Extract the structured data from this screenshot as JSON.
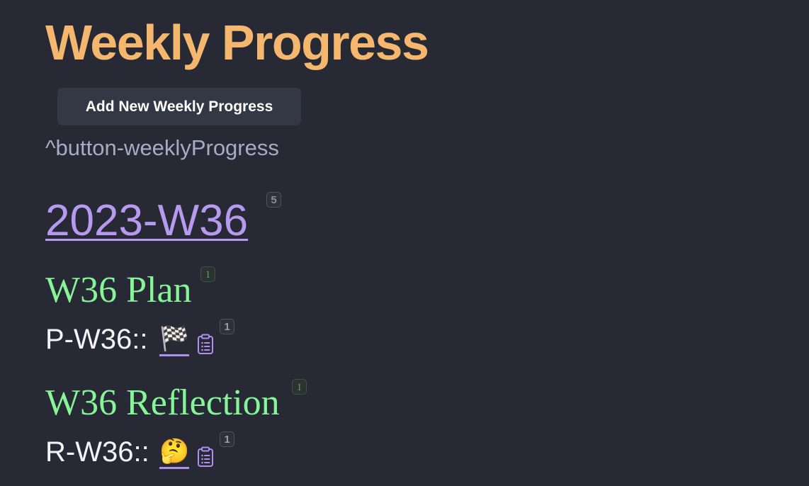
{
  "page": {
    "title": "Weekly Progress"
  },
  "button": {
    "label": "Add New Weekly Progress"
  },
  "block_ref": "^button-weeklyProgress",
  "week": {
    "link_label": "2023-W36",
    "count_badge": "5"
  },
  "plan": {
    "heading": "W36 Plan",
    "heading_badge": "1",
    "field_label": "P-W36::",
    "emoji": "🏁",
    "emoji_name": "chequered-flag",
    "badge": "1",
    "icon": "clipboard-list-icon"
  },
  "reflection": {
    "heading": "W36 Reflection",
    "heading_badge": "1",
    "field_label": "R-W36::",
    "emoji": "🤔",
    "emoji_name": "thinking-face",
    "badge": "1",
    "icon": "clipboard-list-icon"
  },
  "colors": {
    "background": "#272a35",
    "title": "#f4b76d",
    "link": "#b79af0",
    "heading": "#86f598",
    "icon": "#b08ff0"
  }
}
